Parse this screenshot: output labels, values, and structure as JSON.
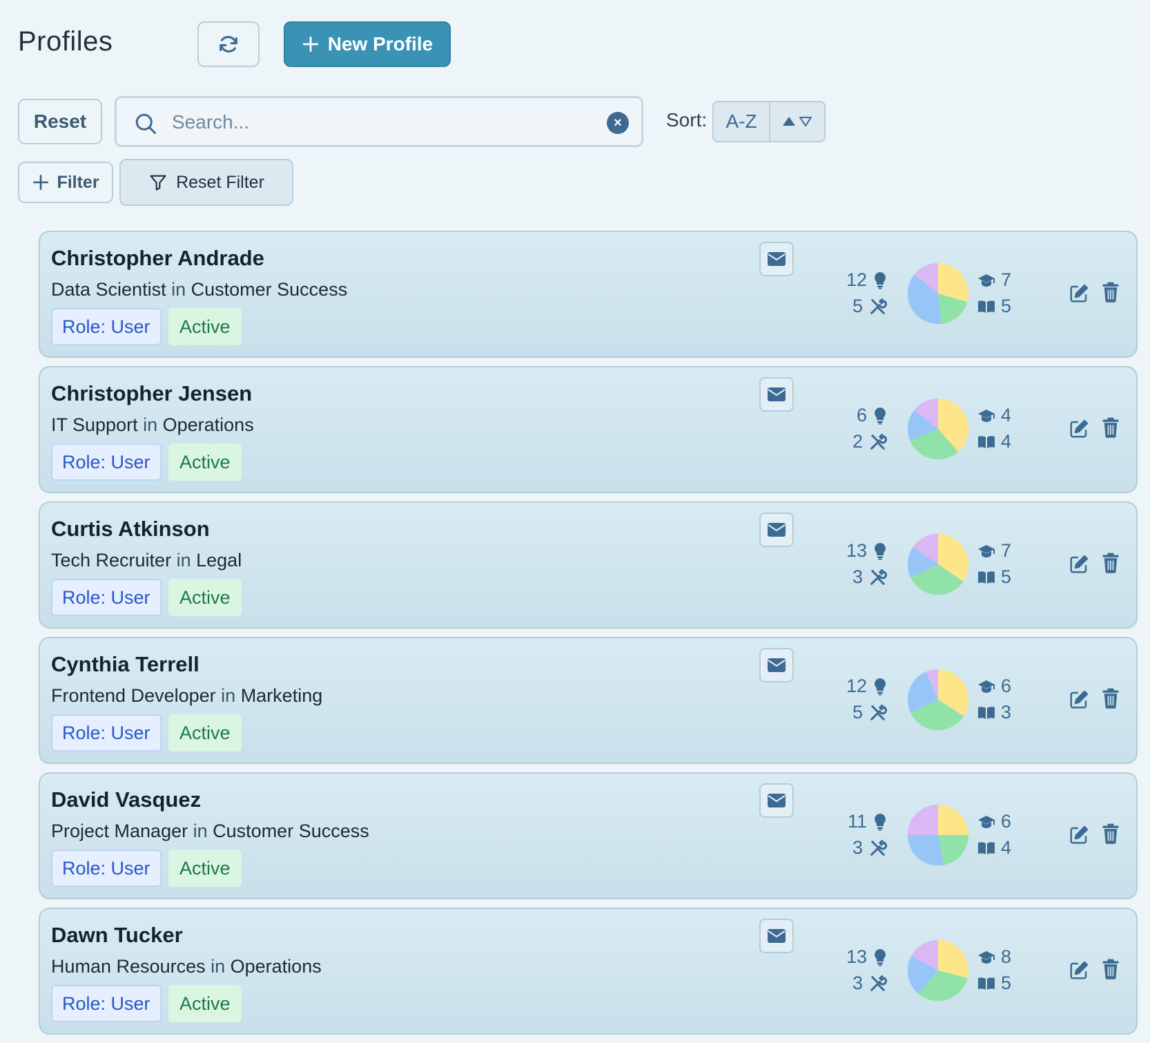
{
  "header": {
    "title": "Profiles",
    "new_profile_label": "New Profile"
  },
  "toolbar": {
    "reset_label": "Reset",
    "search_placeholder": "Search...",
    "sort_label": "Sort:",
    "sort_value": "A-Z",
    "filter_label": "Filter",
    "reset_filter_label": "Reset Filter"
  },
  "colors": {
    "accent": "#3a93b5",
    "pie_purple": "#d9b8f5",
    "pie_yellow": "#fde58a",
    "pie_green": "#8fe3a8",
    "pie_blue": "#98c5f7",
    "icon": "#3d6a92"
  },
  "profiles": [
    {
      "name": "Christopher Andrade",
      "title": "Data Scientist",
      "in": "in",
      "department": "Customer Success",
      "role": "Role: User",
      "status": "Active",
      "ideas": "12",
      "skills": "5",
      "education": "7",
      "books": "5",
      "pie": [
        0.25,
        0.16,
        0.32,
        0.12
      ]
    },
    {
      "name": "Christopher Jensen",
      "title": "IT Support",
      "in": "in",
      "department": "Operations",
      "role": "Role: User",
      "status": "Active",
      "ideas": "6",
      "skills": "2",
      "education": "4",
      "books": "4",
      "pie": [
        0.32,
        0.25,
        0.14,
        0.12
      ]
    },
    {
      "name": "Curtis Atkinson",
      "title": "Tech Recruiter",
      "in": "in",
      "department": "Legal",
      "role": "Role: User",
      "status": "Active",
      "ideas": "13",
      "skills": "3",
      "education": "7",
      "books": "5",
      "pie": [
        0.29,
        0.28,
        0.14,
        0.13
      ]
    },
    {
      "name": "Cynthia Terrell",
      "title": "Frontend Developer",
      "in": "in",
      "department": "Marketing",
      "role": "Role: User",
      "status": "Active",
      "ideas": "12",
      "skills": "5",
      "education": "6",
      "books": "3",
      "pie": [
        0.32,
        0.32,
        0.24,
        0.06
      ]
    },
    {
      "name": "David Vasquez",
      "title": "Project Manager",
      "in": "in",
      "department": "Customer Success",
      "role": "Role: User",
      "status": "Active",
      "ideas": "11",
      "skills": "3",
      "education": "6",
      "books": "4",
      "pie": [
        0.25,
        0.22,
        0.28,
        0.25
      ]
    },
    {
      "name": "Dawn Tucker",
      "title": "Human Resources",
      "in": "in",
      "department": "Operations",
      "role": "Role: User",
      "status": "Active",
      "ideas": "13",
      "skills": "3",
      "education": "8",
      "books": "5",
      "pie": [
        0.29,
        0.32,
        0.22,
        0.17
      ]
    }
  ]
}
